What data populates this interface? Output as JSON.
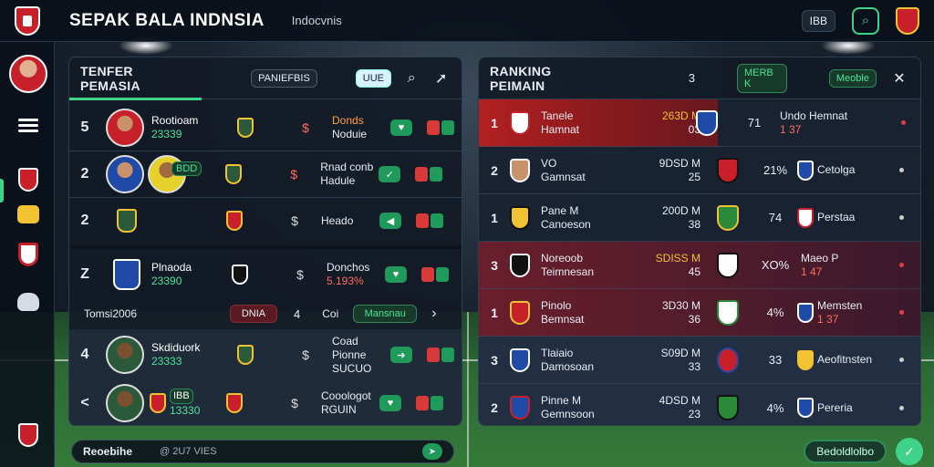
{
  "app": {
    "title": "SEPAK BALA INDNSIA",
    "region": "Indocvnis"
  },
  "topbar": {
    "chip": "IBB",
    "search_icon": "search-icon"
  },
  "colors": {
    "accent": "#3fd38a",
    "brand_red": "#c8202a",
    "gold": "#f1c232"
  },
  "left_panel": {
    "title": "TENFER PEMASIA",
    "chip": "PANIEFBIS",
    "badge": "UUE",
    "rows": [
      {
        "num": "5",
        "name": "Rootioam",
        "value": "23339",
        "price_top": "Donds",
        "price_bottom": "Noduie"
      },
      {
        "num": "2",
        "name": "",
        "value": "",
        "tag": "BDD",
        "price_top": "Rnad conb",
        "price_bottom": "Hadule"
      },
      {
        "num": "2",
        "name": "",
        "value": "",
        "price_top": "",
        "price_bottom": "Heado"
      },
      {
        "num": "Z",
        "name": "Plnaoda",
        "value": "23390",
        "price_top": "Donchos",
        "price_bottom": "5.193%"
      },
      {
        "num": "4",
        "name": "Skdiduork",
        "value": "23333",
        "price_top": "Coad Pionne",
        "price_bottom": "SUCUO"
      },
      {
        "num": "<",
        "name": "",
        "value": "13330",
        "tag": "IBB",
        "price_top": "Cooologot",
        "price_bottom": "RGUIN"
      }
    ],
    "subbar": {
      "label": "Tomsi2006",
      "tag": "DNIA",
      "num": "4",
      "mid": "Coi",
      "action": "Mansnau"
    }
  },
  "right_panel": {
    "title": "RANKING PEIMAIN",
    "num": "3",
    "chip1": "MERB K",
    "chip2": "Meoble",
    "rows": [
      {
        "rank": "1",
        "team": "Tanele",
        "sub": "Hamnat",
        "score_top": "263D M",
        "score_bottom": "03",
        "pct": "71",
        "rt": "Undo",
        "rt2": "Hemnat",
        "rt3": "1 37"
      },
      {
        "rank": "2",
        "team": "VO",
        "sub": "Gamnsat",
        "score_top": "9DSD M",
        "score_bottom": "25",
        "pct": "21%",
        "rt": "",
        "rt2": "Cetolga",
        "rt3": ""
      },
      {
        "rank": "1",
        "team": "Pane M",
        "sub": "Canoeson",
        "score_top": "200D M",
        "score_bottom": "38",
        "pct": "74",
        "rt": "",
        "rt2": "Perstaa",
        "rt3": ""
      },
      {
        "rank": "3",
        "team": "Noreoob",
        "sub": "Teimnesan",
        "score_top": "SDISS M",
        "score_bottom": "45",
        "pct": "XO%",
        "rt": "Maeo",
        "rt2": "P",
        "rt3": "1 47"
      },
      {
        "rank": "1",
        "team": "Pinolo",
        "sub": "Bemnsat",
        "score_top": "3D30 M",
        "score_bottom": "36",
        "pct": "4%",
        "rt": "",
        "rt2": "Memsten",
        "rt3": "1 37"
      },
      {
        "rank": "3",
        "team": "Tlaiaio",
        "sub": "Damosoan",
        "score_top": "S09D M",
        "score_bottom": "33",
        "pct": "33",
        "rt": "",
        "rt2": "Aeofitnsten",
        "rt3": ""
      },
      {
        "rank": "2",
        "team": "Pinne M",
        "sub": "Gemnsoon",
        "score_top": "4DSD M",
        "score_bottom": "23",
        "pct": "4%",
        "rt": "",
        "rt2": "Pereria",
        "rt3": ""
      }
    ]
  },
  "bottombar": {
    "label": "Reoebihe",
    "text": "@ 2U7 VIES",
    "pill": "Bedoldlolbo"
  }
}
